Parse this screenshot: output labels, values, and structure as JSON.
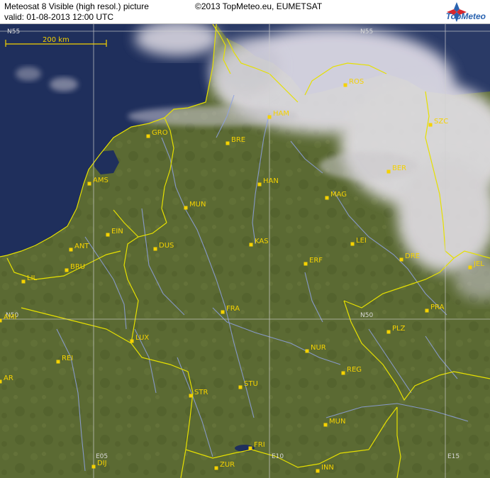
{
  "header": {
    "title": "Meteosat 8 Visible (high resol.) picture",
    "valid": "valid:  01-08-2013  12:00 UTC",
    "copyright": "©2013 TopMeteo.eu, EUMETSAT",
    "logo_text": "TopMeteo"
  },
  "scale_bar": {
    "label": "200 km"
  },
  "grid": {
    "lat_labels": [
      "N55",
      "N55",
      "N50",
      "N50"
    ],
    "lon_labels": [
      "E05",
      "E10",
      "E15"
    ]
  },
  "cities": [
    {
      "code": "ROS"
    },
    {
      "code": "HAM"
    },
    {
      "code": "SZC"
    },
    {
      "code": "GRO"
    },
    {
      "code": "BRE"
    },
    {
      "code": "AMS"
    },
    {
      "code": "HAN"
    },
    {
      "code": "BER"
    },
    {
      "code": "MAG"
    },
    {
      "code": "MUN"
    },
    {
      "code": "EIN"
    },
    {
      "code": "ANT"
    },
    {
      "code": "DUS"
    },
    {
      "code": "KAS"
    },
    {
      "code": "LEI"
    },
    {
      "code": "BRU"
    },
    {
      "code": "ERF"
    },
    {
      "code": "DRE"
    },
    {
      "code": "JEL"
    },
    {
      "code": "LIL"
    },
    {
      "code": "FRA"
    },
    {
      "code": "PRA"
    },
    {
      "code": "AMI"
    },
    {
      "code": "PLZ"
    },
    {
      "code": "LUX"
    },
    {
      "code": "NUR"
    },
    {
      "code": "REI"
    },
    {
      "code": "REG"
    },
    {
      "code": "AR"
    },
    {
      "code": "STU"
    },
    {
      "code": "STR"
    },
    {
      "code": "MUN"
    },
    {
      "code": "FRI"
    },
    {
      "code": "DIJ"
    },
    {
      "code": "ZUR"
    },
    {
      "code": "INN"
    }
  ],
  "colors": {
    "land": "#5a6a32",
    "sea": "#1e2e5a",
    "border": "#e6e000",
    "river": "#8c9ee0",
    "label": "#f5d200",
    "cloud": "#e8e4ec"
  }
}
